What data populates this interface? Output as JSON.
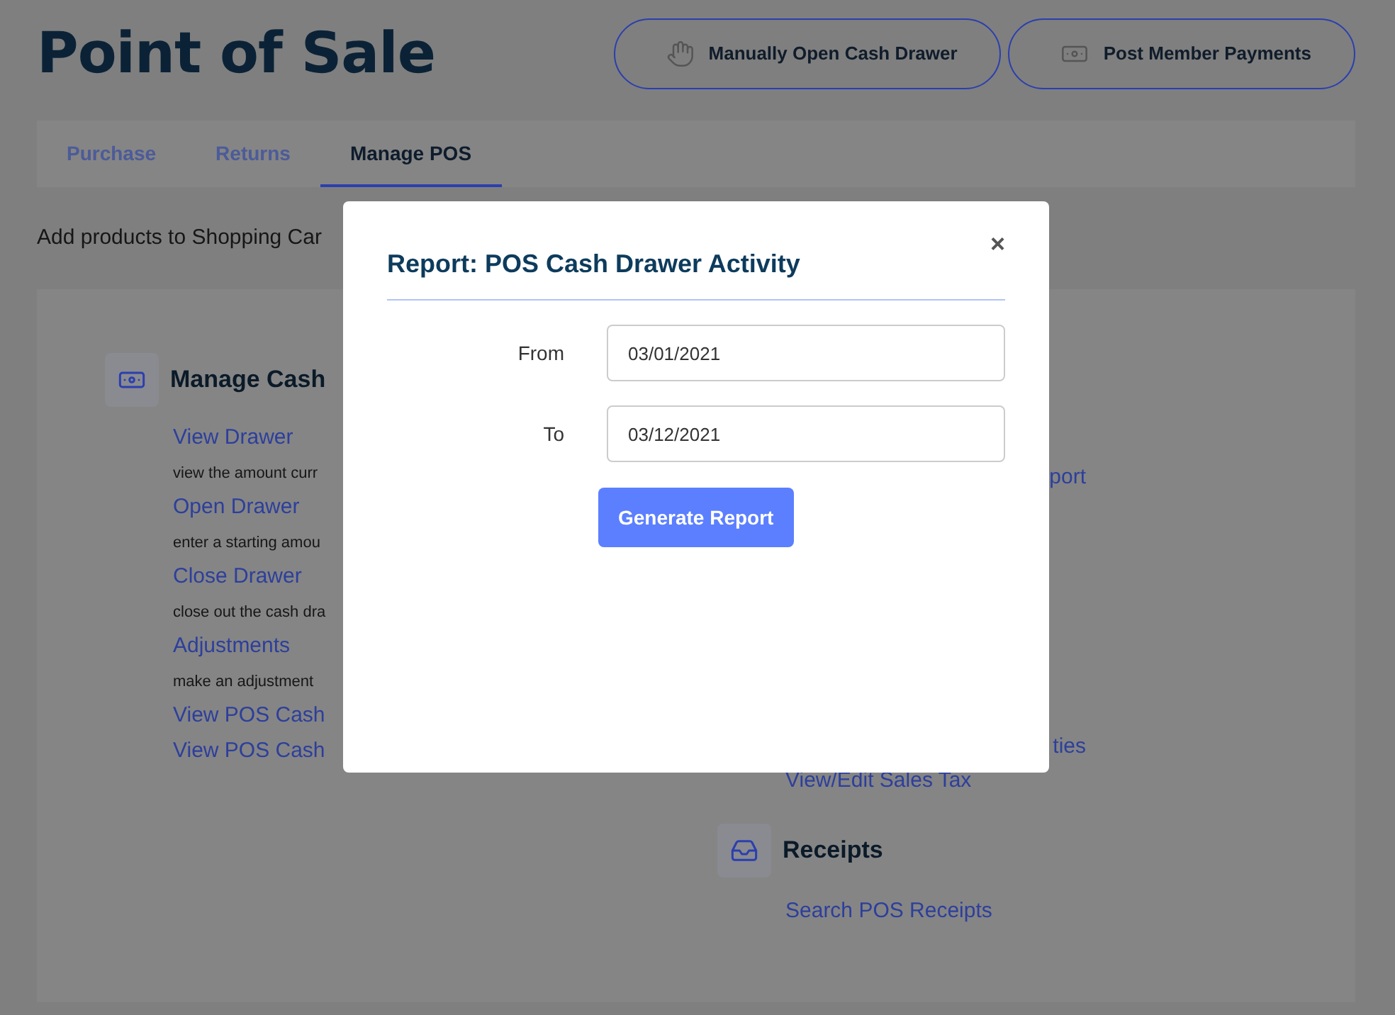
{
  "page": {
    "title": "Point of Sale",
    "subtitle": "Add products to Shopping Car"
  },
  "header_buttons": [
    {
      "label": "Manually Open Cash Drawer"
    },
    {
      "label": "Post Member Payments"
    }
  ],
  "tabs": [
    {
      "label": "Purchase",
      "selected": false
    },
    {
      "label": "Returns",
      "selected": false
    },
    {
      "label": "Manage POS",
      "selected": true
    }
  ],
  "left_section": {
    "heading": "Manage Cash",
    "items": [
      {
        "kind": "link",
        "text": "View Drawer"
      },
      {
        "kind": "desc",
        "text": "view the amount curr"
      },
      {
        "kind": "link",
        "text": "Open Drawer"
      },
      {
        "kind": "desc",
        "text": "enter a starting amou"
      },
      {
        "kind": "link",
        "text": "Close Drawer"
      },
      {
        "kind": "desc",
        "text": "close out the cash dra"
      },
      {
        "kind": "link",
        "text": "Adjustments"
      },
      {
        "kind": "desc",
        "text": "make an adjustment"
      },
      {
        "kind": "link",
        "text": "View POS Cash"
      },
      {
        "kind": "link",
        "text": "View POS Cash"
      }
    ]
  },
  "right_fragments": [
    {
      "kind": "fragment",
      "text": "port"
    },
    {
      "kind": "fragment",
      "text": "ties"
    },
    {
      "kind": "link",
      "text": "View/Edit Sales Tax"
    }
  ],
  "right_section": {
    "heading": "Receipts",
    "items": [
      {
        "kind": "link",
        "text": "Search POS Receipts"
      }
    ]
  },
  "modal": {
    "title": "Report: POS Cash Drawer Activity",
    "close": "×",
    "fields": [
      {
        "label": "From",
        "value": "03/01/2021"
      },
      {
        "label": "To",
        "value": "03/12/2021"
      }
    ],
    "button": "Generate Report"
  }
}
